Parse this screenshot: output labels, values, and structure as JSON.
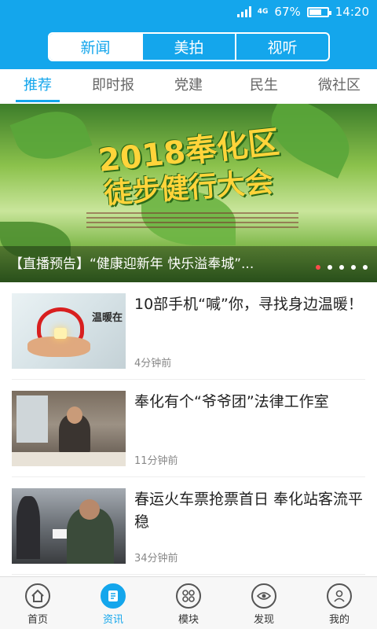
{
  "status_bar": {
    "battery_percent": "67%",
    "battery_level": 0.67,
    "time": "14:20",
    "network": "4G"
  },
  "header": {
    "segments": [
      "新闻",
      "美拍",
      "视听"
    ],
    "active_segment": "新闻"
  },
  "tabs": [
    "推荐",
    "即时报",
    "党建",
    "民生",
    "微社区"
  ],
  "active_tab": "推荐",
  "banner": {
    "title_line1": "2018奉化区",
    "title_line2": "徒步健行大会",
    "caption": "【直播预告】“健康迎新年 快乐溢奉城”...",
    "slide_count": 5,
    "active_slide": 1
  },
  "news": [
    {
      "title": "10部手机“喊”你，寻找身边温暖！",
      "time": "4分钟前",
      "thumb_text": "温暖在"
    },
    {
      "title": "奉化有个“爷爷团”法律工作室",
      "time": "11分钟前"
    },
    {
      "title": "春运火车票抢票首日 奉化站客流平稳",
      "time": "34分钟前"
    }
  ],
  "bottom_nav": [
    {
      "label": "首页",
      "icon": "home-icon"
    },
    {
      "label": "资讯",
      "icon": "news-icon"
    },
    {
      "label": "模块",
      "icon": "grid-icon"
    },
    {
      "label": "发现",
      "icon": "eye-icon"
    },
    {
      "label": "我的",
      "icon": "user-icon"
    }
  ],
  "active_nav": "资讯",
  "colors": {
    "accent": "#14a6ec",
    "active_dot": "#ff4b4b"
  }
}
